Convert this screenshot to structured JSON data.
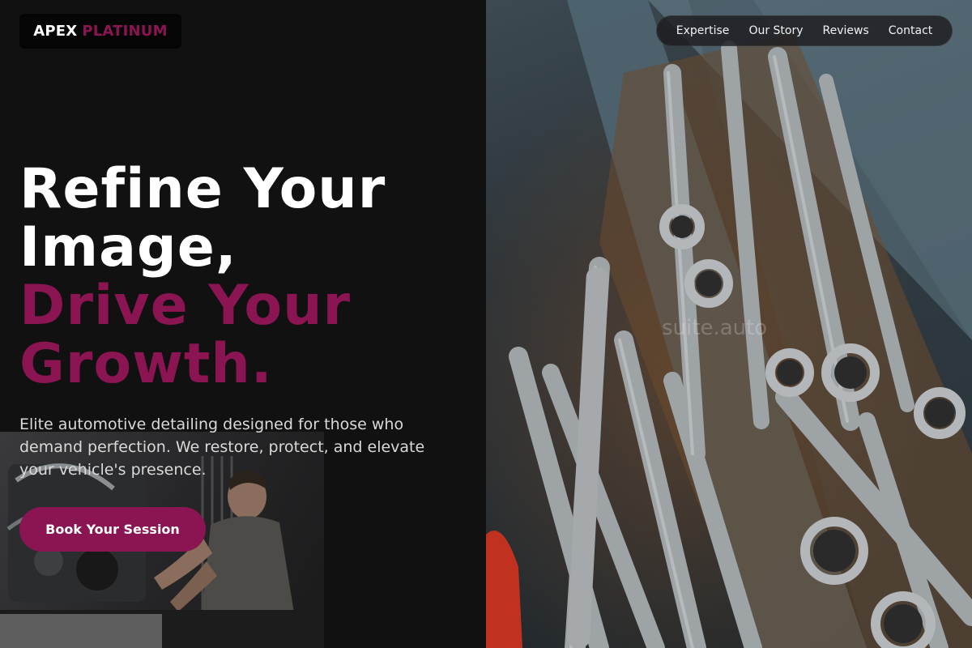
{
  "logo": {
    "primary": "APEX",
    "secondary": "PLATINUM"
  },
  "nav": {
    "items": [
      {
        "label": "Expertise"
      },
      {
        "label": "Our Story"
      },
      {
        "label": "Reviews"
      },
      {
        "label": "Contact"
      }
    ]
  },
  "hero": {
    "title_line1": "Refine Your",
    "title_line2": "Image,",
    "title_line3": "Drive Your",
    "title_line4": "Growth.",
    "subtitle": "Elite automotive detailing designed for those who demand perfection. We restore, protect, and elevate your vehicle's presence.",
    "cta_label": "Book Your Session"
  },
  "watermark": "suite.auto",
  "colors": {
    "accent": "#8b1552",
    "background": "#111112",
    "text": "#ffffff"
  }
}
